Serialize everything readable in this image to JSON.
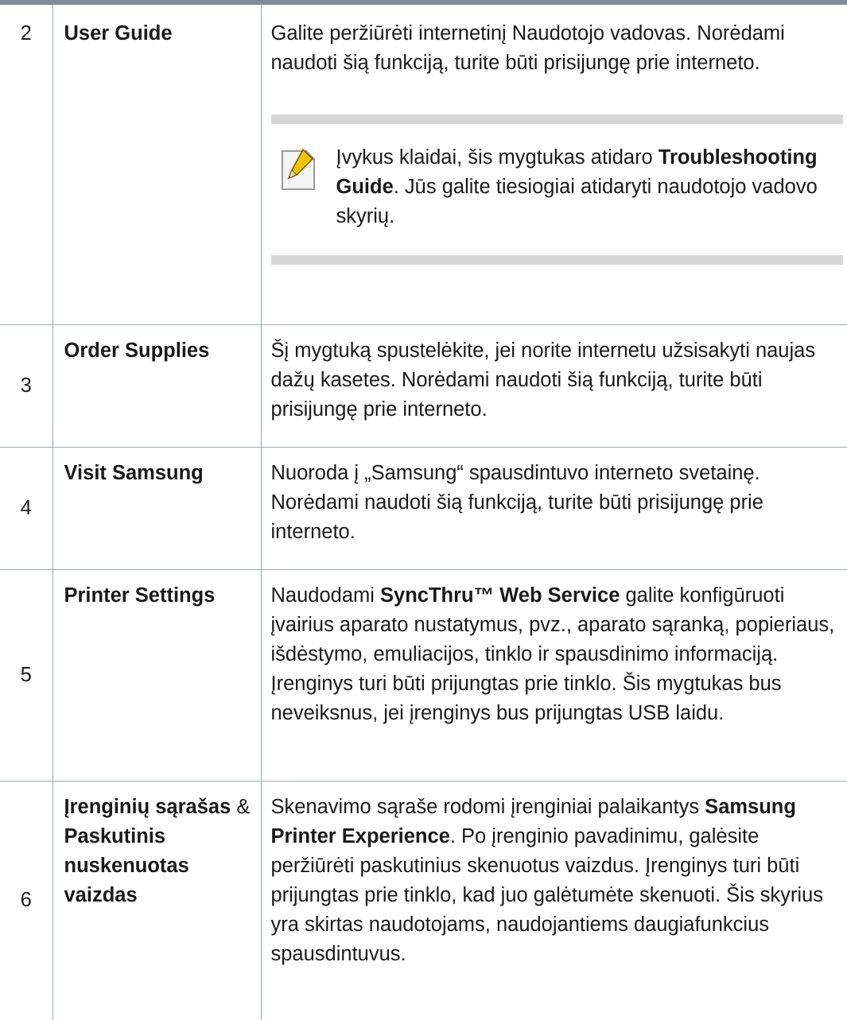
{
  "rows": [
    {
      "num": "2",
      "name": "User Guide",
      "desc": "Galite peržiūrėti internetinį Naudotojo vadovas. Norėdami naudoti šią funkciją, turite būti prisijungę prie interneto.",
      "note": {
        "icon": "note-pencil-icon",
        "text1": "Įvykus klaidai, šis mygtukas atidaro ",
        "bold1": "Troubleshooting Guide",
        "text2": ". Jūs galite tiesiogiai atidaryti naudotojo vadovo skyrių."
      }
    },
    {
      "num": "3",
      "name": "Order Supplies",
      "desc": "Šį mygtuką spustelėkite, jei norite internetu užsisakyti naujas dažų kasetes. Norėdami naudoti šią funkciją, turite būti prisijungę prie interneto."
    },
    {
      "num": "4",
      "name": "Visit Samsung",
      "desc": "Nuoroda į „Samsung“ spausdintuvo interneto svetainę. Norėdami naudoti šią funkciją, turite būti prisijungę prie interneto."
    },
    {
      "num": "5",
      "name": "Printer Settings",
      "desc_pre": "Naudodami ",
      "desc_bold": "SyncThru™ Web Service",
      "desc_post": " galite konfigūruoti įvairius aparato nustatymus, pvz., aparato sąranką, popieriaus, išdėstymo, emuliacijos, tinklo ir spausdinimo informaciją. Įrenginys turi būti prijungtas prie tinklo. Šis mygtukas bus neveiksnus, jei įrenginys bus prijungtas USB laidu."
    },
    {
      "num": "6",
      "name_part1": "Įrenginių sąrašas",
      "name_amp": " & ",
      "name_part2": "Paskutinis nuskenuotas vaizdas",
      "desc_pre": "Skenavimo sąraše rodomi įrenginiai palaikantys ",
      "desc_bold": "Samsung Printer Experience",
      "desc_post": ". Po įrenginio pavadinimu, galėsite peržiūrėti paskutinius skenuotus vaizdus. Įrenginys turi būti prijungtas prie tinklo, kad juo galėtumėte skenuoti. Šis skyrius yra skirtas naudotojams, naudojantiems daugiafunkcius spausdintuvus."
    }
  ],
  "colors": {
    "rule": "#7d8c99",
    "border": "#9aa6b0",
    "note_band": "#d6d6d6",
    "icon_accent": "#f5c400"
  }
}
